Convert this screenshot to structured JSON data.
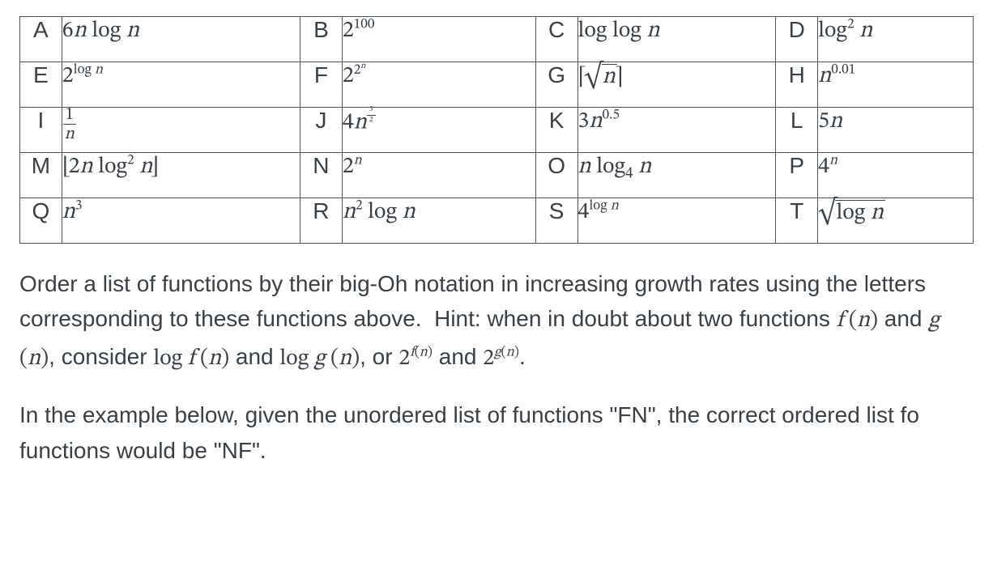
{
  "cells": {
    "A": {
      "label": "A",
      "expr_html": "6<span class='ital'>n</span> log <span class='ital'>n</span>"
    },
    "B": {
      "label": "B",
      "expr_html": "2<sup>100</sup>"
    },
    "C": {
      "label": "C",
      "expr_html": "log log <span class='ital'>n</span>"
    },
    "D": {
      "label": "D",
      "expr_html": "log<sup>2</sup> <span class='ital'>n</span>"
    },
    "E": {
      "label": "E",
      "expr_html": "2<sup>log <span class='ital'>n</span></sup>"
    },
    "F": {
      "label": "F",
      "expr_html": "2<sup>2<sup><span class='ital'>n</span></sup></sup>"
    },
    "G": {
      "label": "G",
      "expr_html": "<span class='ceil-l'>⌈</span><span class='sqrt'><span class='radicand'><span class='ital'>n</span></span></span><span class='ceil-r'>⌉</span>"
    },
    "H": {
      "label": "H",
      "expr_html": "<span class='ital'>n</span><sup>0.01</sup>"
    },
    "I": {
      "label": "I",
      "expr_html": "<span class='frac'><span class='num'>1</span><span class='den'><span class='ital'>n</span></span></span>"
    },
    "J": {
      "label": "J",
      "expr_html": "4<span class='ital'>n</span><sup><span class='frac frac-small'><span class='num'>3</span><span class='den'>2</span></span></sup>"
    },
    "K": {
      "label": "K",
      "expr_html": "3<span class='ital'>n</span><sup>0.5</sup>"
    },
    "L": {
      "label": "L",
      "expr_html": "5<span class='ital'>n</span>"
    },
    "M": {
      "label": "M",
      "expr_html": "<span class='floor-l'>⌊</span>2<span class='ital'>n</span> log<sup>2</sup> <span class='ital'>n</span><span class='floor-r'>⌋</span>"
    },
    "N": {
      "label": "N",
      "expr_html": "2<sup><span class='ital'>n</span></sup>"
    },
    "O": {
      "label": "O",
      "expr_html": "<span class='ital'>n</span> log<sub>4</sub> <span class='ital'>n</span>"
    },
    "P": {
      "label": "P",
      "expr_html": "4<sup><span class='ital'>n</span></sup>"
    },
    "Q": {
      "label": "Q",
      "expr_html": "<span class='ital'>n</span><sup>3</sup>"
    },
    "R": {
      "label": "R",
      "expr_html": "<span class='ital'>n</span><sup>2</sup> log <span class='ital'>n</span>"
    },
    "S": {
      "label": "S",
      "expr_html": "4<sup>log <span class='ital'>n</span></sup>"
    },
    "T": {
      "label": "T",
      "expr_html": "<span class='sqrt'><span class='radicand'>log <span class='ital'>n</span></span></span>"
    }
  },
  "layout": [
    [
      "A",
      "B",
      "C",
      "D"
    ],
    [
      "E",
      "F",
      "G",
      "H"
    ],
    [
      "I",
      "J",
      "K",
      "L"
    ],
    [
      "M",
      "N",
      "O",
      "P"
    ],
    [
      "Q",
      "R",
      "S",
      "T"
    ]
  ],
  "widths_pct": [
    4.4,
    25.0,
    4.4,
    20.3,
    4.4,
    20.8,
    4.4,
    16.3
  ],
  "paragraphs": {
    "instruction_html": "Order a list of functions by their big-Oh notation in increasing growth rates using the letters corresponding to these functions above. &nbsp;Hint: when in doubt about two functions <span class='math'><span class='ital'>f</span> (<span class='ital'>n</span>)</span> and <span class='math'><span class='ital'>g</span> (<span class='ital'>n</span>)</span>, consider <span class='math'>log <span class='ital'>f</span> (<span class='ital'>n</span>)</span> and <span class='math'>log <span class='ital'>g</span> (<span class='ital'>n</span>)</span>, or <span class='math'>2<sup><span class='ital'>f</span>(<span class='ital'>n</span>)</sup></span> and <span class='math'>2<sup><span class='ital'>g</span>(<span class='ital'>n</span>)</sup></span>.",
    "example_html": "In the example below, given the unordered list of functions \"FN\", the correct ordered list fo functions would be \"NF\"."
  }
}
